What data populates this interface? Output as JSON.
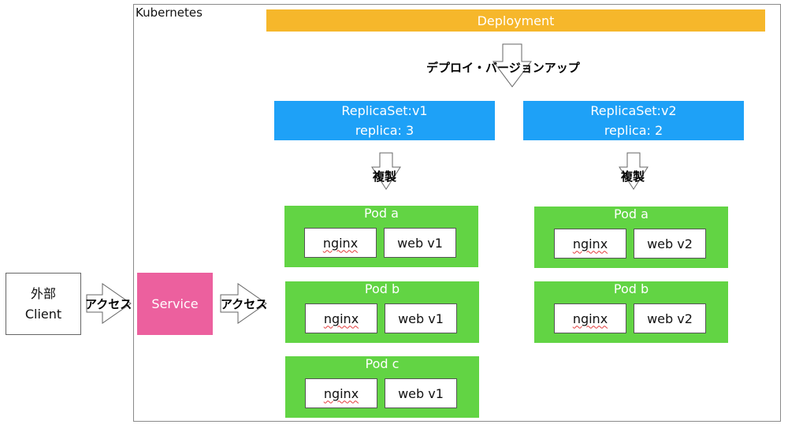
{
  "kubernetes": {
    "label": "Kubernetes"
  },
  "deployment": {
    "label": "Deployment",
    "color": "#f6b72b"
  },
  "deploy_arrow": {
    "label": "デプロイ・バージョンアップ"
  },
  "replicasets": [
    {
      "name": "ReplicaSet:v1",
      "replica": "replica: 3",
      "arrow_label": "複製",
      "pods": [
        {
          "name": "Pod a",
          "containers": [
            "nginx",
            "web v1"
          ]
        },
        {
          "name": "Pod b",
          "containers": [
            "nginx",
            "web v1"
          ]
        },
        {
          "name": "Pod c",
          "containers": [
            "nginx",
            "web v1"
          ]
        }
      ]
    },
    {
      "name": "ReplicaSet:v2",
      "replica": "replica: 2",
      "arrow_label": "複製",
      "pods": [
        {
          "name": "Pod a",
          "containers": [
            "nginx",
            "web v2"
          ]
        },
        {
          "name": "Pod b",
          "containers": [
            "nginx",
            "web v2"
          ]
        }
      ]
    }
  ],
  "client": {
    "line1": "外部",
    "line2": "Client"
  },
  "service": {
    "label": "Service",
    "color": "#ec609e"
  },
  "access_arrows": [
    {
      "label": "アクセス"
    },
    {
      "label": "アクセス"
    }
  ],
  "colors": {
    "replicaset": "#1ea1f7",
    "pod": "#62d444"
  }
}
